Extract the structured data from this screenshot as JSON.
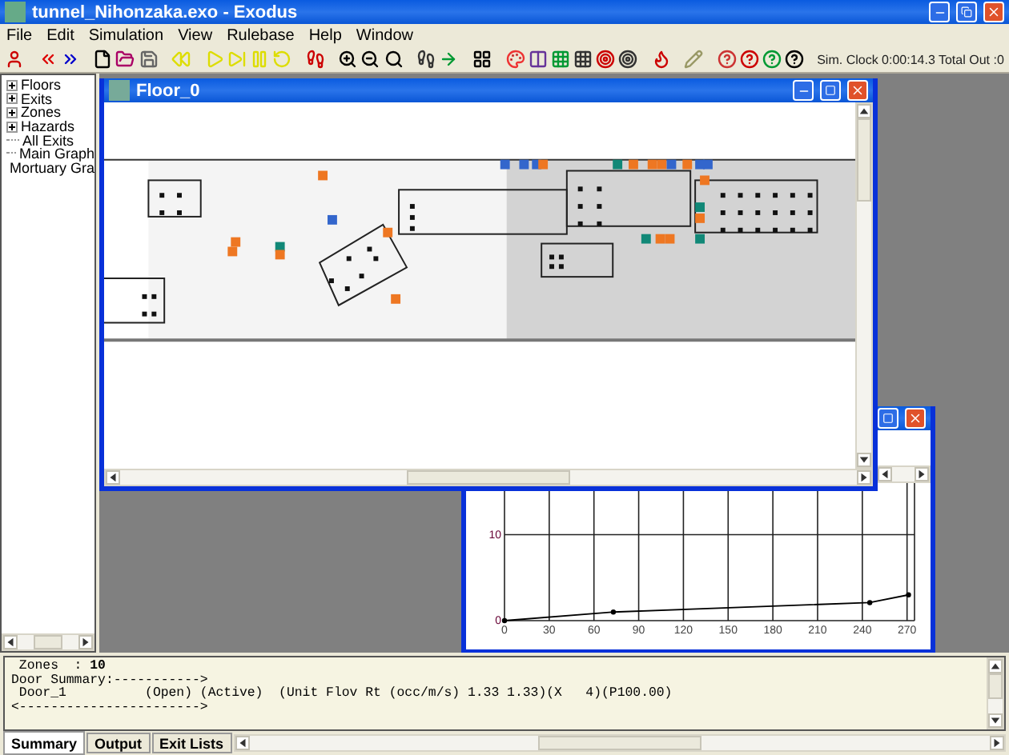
{
  "window": {
    "title": "tunnel_Nihonzaka.exo - Exodus"
  },
  "menu": [
    "File",
    "Edit",
    "Simulation",
    "View",
    "Rulebase",
    "Help",
    "Window"
  ],
  "toolbar": {
    "status": "Sim. Clock  0:00:14.3 Total Out :0"
  },
  "tree": [
    {
      "label": "Floors",
      "kind": "folder",
      "expanded": false
    },
    {
      "label": "Exits",
      "kind": "folder",
      "expanded": false
    },
    {
      "label": "Zones",
      "kind": "folder",
      "expanded": false
    },
    {
      "label": "Hazards",
      "kind": "folder",
      "expanded": false
    },
    {
      "label": "All Exits",
      "kind": "leaf"
    },
    {
      "label": "Main Graph",
      "kind": "leaf"
    },
    {
      "label": "Mortuary Gra",
      "kind": "leaf"
    }
  ],
  "floor_window": {
    "title": "Floor_0"
  },
  "graph_window": {
    "chart_data": {
      "type": "line",
      "grid": true,
      "x": [
        0,
        73,
        245,
        271
      ],
      "series": [
        {
          "color": "#000000",
          "marker": "circle",
          "values": [
            0,
            1,
            2.1,
            3
          ]
        }
      ],
      "xlim": [
        0,
        275
      ],
      "ylim": [
        0,
        16
      ],
      "xticks": [
        0,
        30,
        60,
        90,
        120,
        150,
        180,
        210,
        240,
        270
      ],
      "yticks": [
        0,
        10
      ]
    }
  },
  "output": {
    "lines": [
      " Zones  : **10**",
      "Door Summary:----------->",
      " Door_1          (Open) (Active)  (Unit Flov Rt (occ/m/s) 1.33 1.33)(X   4)(P100.00)",
      "<----------------------->"
    ]
  },
  "tabs": [
    {
      "label": "Summary",
      "selected": true
    },
    {
      "label": "Output",
      "selected": false
    },
    {
      "label": "Exit Lists",
      "selected": false
    }
  ]
}
